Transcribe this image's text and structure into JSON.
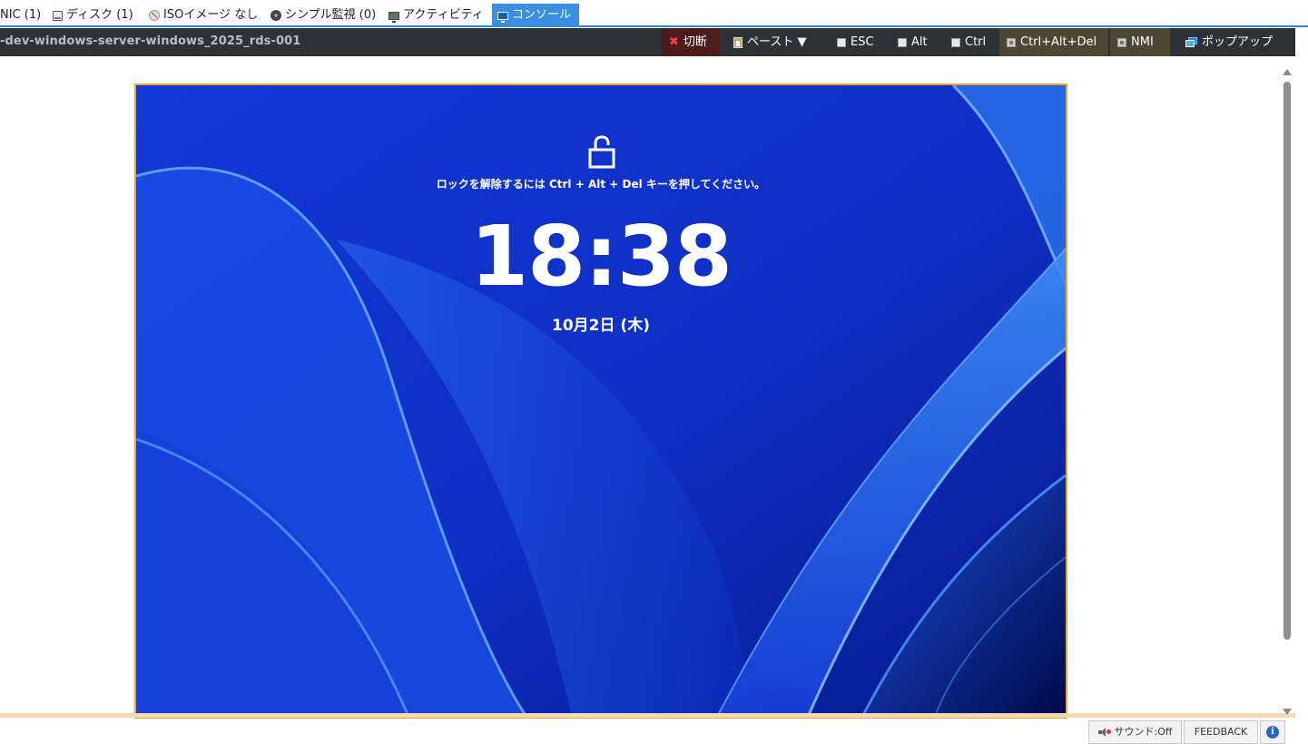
{
  "tabs": [
    {
      "id": "nic",
      "label": "NIC (1)",
      "icon": "nic-icon"
    },
    {
      "id": "disk",
      "label": "ディスク (1)",
      "icon": "disk-icon"
    },
    {
      "id": "iso",
      "label": "ISOイメージ なし",
      "icon": "iso-icon"
    },
    {
      "id": "monitor",
      "label": "シンプル監視 (0)",
      "icon": "monitor-icon"
    },
    {
      "id": "activity",
      "label": "アクティビティ",
      "icon": "activity-icon"
    },
    {
      "id": "console",
      "label": "コンソール",
      "icon": "console-icon",
      "active": true
    }
  ],
  "toolbar": {
    "server_name": "-dev-windows-server-windows_2025_rds-001",
    "disconnect": "切断",
    "paste": "ペースト ▼",
    "esc": "ESC",
    "alt": "Alt",
    "ctrl": "Ctrl",
    "ctrl_alt_del": "Ctrl+Alt+Del",
    "nmi": "NMI",
    "popup": "ポップアップ"
  },
  "lockscreen": {
    "message": "ロックを解除するには Ctrl + Alt + Del キーを押してください。",
    "time": "18:38",
    "date": "10月2日 (木)"
  },
  "status": {
    "sound": "サウンド:Off",
    "feedback": "FEEDBACK",
    "info": "i"
  },
  "colors": {
    "accent": "#3b8fe0",
    "toolbar_bg": "#2c3236",
    "console_border": "#f0a52a",
    "wallpaper": "#1234c8"
  }
}
